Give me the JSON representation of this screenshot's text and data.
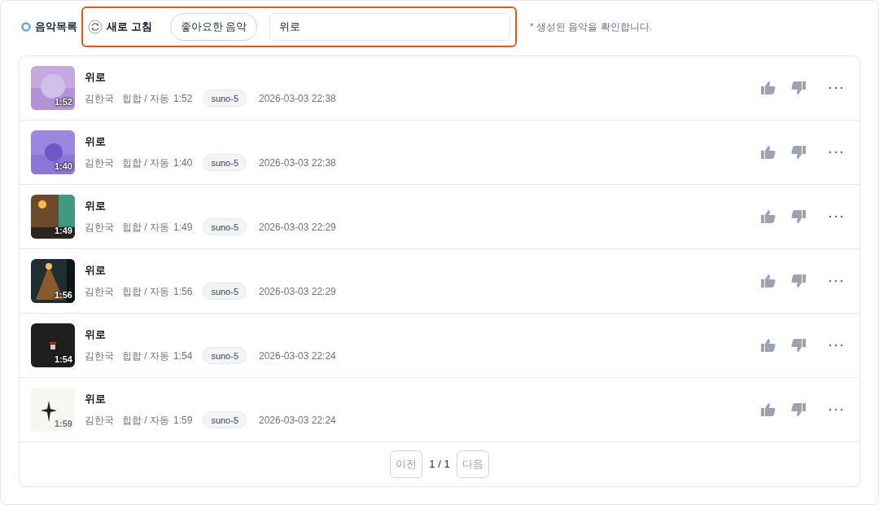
{
  "header": {
    "section_label": "음악목록",
    "refresh_label": "새로 고침",
    "liked_button": "좋아요한 음악",
    "search": {
      "value": "위로"
    },
    "hint": "* 생성된 음악을 확인합니다."
  },
  "songs": [
    {
      "duration_badge": "1:52",
      "title": "위로",
      "artist": "김한국",
      "genre": "힙합 / 자동",
      "length": "1:52",
      "model": "suno-5",
      "date": "2026-03-03 22:38"
    },
    {
      "duration_badge": "1:40",
      "title": "위로",
      "artist": "김한국",
      "genre": "힙합 / 자동",
      "length": "1:40",
      "model": "suno-5",
      "date": "2026-03-03 22:38"
    },
    {
      "duration_badge": "1:49",
      "title": "위로",
      "artist": "김한국",
      "genre": "힙합 / 자동",
      "length": "1:49",
      "model": "suno-5",
      "date": "2026-03-03 22:29"
    },
    {
      "duration_badge": "1:56",
      "title": "위로",
      "artist": "김한국",
      "genre": "힙합 / 자동",
      "length": "1:56",
      "model": "suno-5",
      "date": "2026-03-03 22:29"
    },
    {
      "duration_badge": "1:54",
      "title": "위로",
      "artist": "김한국",
      "genre": "힙합 / 자동",
      "length": "1:54",
      "model": "suno-5",
      "date": "2026-03-03 22:24"
    },
    {
      "duration_badge": "1:59",
      "title": "위로",
      "artist": "김한국",
      "genre": "힙합 / 자동",
      "length": "1:59",
      "model": "suno-5",
      "date": "2026-03-03 22:24"
    }
  ],
  "pagination": {
    "prev": {
      "label": "이전",
      "disabled": true
    },
    "page": "1 / 1",
    "next": {
      "label": "다음",
      "disabled": true
    }
  }
}
